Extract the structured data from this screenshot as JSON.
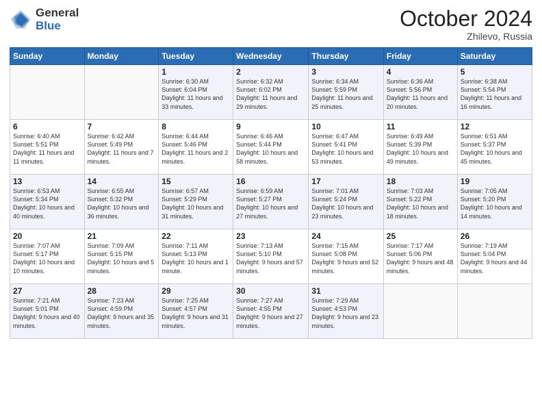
{
  "header": {
    "logo_general": "General",
    "logo_blue": "Blue",
    "month_title": "October 2024",
    "location": "Zhilevo, Russia"
  },
  "weekdays": [
    "Sunday",
    "Monday",
    "Tuesday",
    "Wednesday",
    "Thursday",
    "Friday",
    "Saturday"
  ],
  "weeks": [
    [
      {
        "day": "",
        "info": ""
      },
      {
        "day": "",
        "info": ""
      },
      {
        "day": "1",
        "info": "Sunrise: 6:30 AM\nSunset: 6:04 PM\nDaylight: 11 hours and 33 minutes."
      },
      {
        "day": "2",
        "info": "Sunrise: 6:32 AM\nSunset: 6:02 PM\nDaylight: 11 hours and 29 minutes."
      },
      {
        "day": "3",
        "info": "Sunrise: 6:34 AM\nSunset: 5:59 PM\nDaylight: 11 hours and 25 minutes."
      },
      {
        "day": "4",
        "info": "Sunrise: 6:36 AM\nSunset: 5:56 PM\nDaylight: 11 hours and 20 minutes."
      },
      {
        "day": "5",
        "info": "Sunrise: 6:38 AM\nSunset: 5:54 PM\nDaylight: 11 hours and 16 minutes."
      }
    ],
    [
      {
        "day": "6",
        "info": "Sunrise: 6:40 AM\nSunset: 5:51 PM\nDaylight: 11 hours and 11 minutes."
      },
      {
        "day": "7",
        "info": "Sunrise: 6:42 AM\nSunset: 5:49 PM\nDaylight: 11 hours and 7 minutes."
      },
      {
        "day": "8",
        "info": "Sunrise: 6:44 AM\nSunset: 5:46 PM\nDaylight: 11 hours and 2 minutes."
      },
      {
        "day": "9",
        "info": "Sunrise: 6:46 AM\nSunset: 5:44 PM\nDaylight: 10 hours and 58 minutes."
      },
      {
        "day": "10",
        "info": "Sunrise: 6:47 AM\nSunset: 5:41 PM\nDaylight: 10 hours and 53 minutes."
      },
      {
        "day": "11",
        "info": "Sunrise: 6:49 AM\nSunset: 5:39 PM\nDaylight: 10 hours and 49 minutes."
      },
      {
        "day": "12",
        "info": "Sunrise: 6:51 AM\nSunset: 5:37 PM\nDaylight: 10 hours and 45 minutes."
      }
    ],
    [
      {
        "day": "13",
        "info": "Sunrise: 6:53 AM\nSunset: 5:34 PM\nDaylight: 10 hours and 40 minutes."
      },
      {
        "day": "14",
        "info": "Sunrise: 6:55 AM\nSunset: 5:32 PM\nDaylight: 10 hours and 36 minutes."
      },
      {
        "day": "15",
        "info": "Sunrise: 6:57 AM\nSunset: 5:29 PM\nDaylight: 10 hours and 31 minutes."
      },
      {
        "day": "16",
        "info": "Sunrise: 6:59 AM\nSunset: 5:27 PM\nDaylight: 10 hours and 27 minutes."
      },
      {
        "day": "17",
        "info": "Sunrise: 7:01 AM\nSunset: 5:24 PM\nDaylight: 10 hours and 23 minutes."
      },
      {
        "day": "18",
        "info": "Sunrise: 7:03 AM\nSunset: 5:22 PM\nDaylight: 10 hours and 18 minutes."
      },
      {
        "day": "19",
        "info": "Sunrise: 7:05 AM\nSunset: 5:20 PM\nDaylight: 10 hours and 14 minutes."
      }
    ],
    [
      {
        "day": "20",
        "info": "Sunrise: 7:07 AM\nSunset: 5:17 PM\nDaylight: 10 hours and 10 minutes."
      },
      {
        "day": "21",
        "info": "Sunrise: 7:09 AM\nSunset: 5:15 PM\nDaylight: 10 hours and 5 minutes."
      },
      {
        "day": "22",
        "info": "Sunrise: 7:11 AM\nSunset: 5:13 PM\nDaylight: 10 hours and 1 minute."
      },
      {
        "day": "23",
        "info": "Sunrise: 7:13 AM\nSunset: 5:10 PM\nDaylight: 9 hours and 57 minutes."
      },
      {
        "day": "24",
        "info": "Sunrise: 7:15 AM\nSunset: 5:08 PM\nDaylight: 9 hours and 52 minutes."
      },
      {
        "day": "25",
        "info": "Sunrise: 7:17 AM\nSunset: 5:06 PM\nDaylight: 9 hours and 48 minutes."
      },
      {
        "day": "26",
        "info": "Sunrise: 7:19 AM\nSunset: 5:04 PM\nDaylight: 9 hours and 44 minutes."
      }
    ],
    [
      {
        "day": "27",
        "info": "Sunrise: 7:21 AM\nSunset: 5:01 PM\nDaylight: 9 hours and 40 minutes."
      },
      {
        "day": "28",
        "info": "Sunrise: 7:23 AM\nSunset: 4:59 PM\nDaylight: 9 hours and 35 minutes."
      },
      {
        "day": "29",
        "info": "Sunrise: 7:25 AM\nSunset: 4:57 PM\nDaylight: 9 hours and 31 minutes."
      },
      {
        "day": "30",
        "info": "Sunrise: 7:27 AM\nSunset: 4:55 PM\nDaylight: 9 hours and 27 minutes."
      },
      {
        "day": "31",
        "info": "Sunrise: 7:29 AM\nSunset: 4:53 PM\nDaylight: 9 hours and 23 minutes."
      },
      {
        "day": "",
        "info": ""
      },
      {
        "day": "",
        "info": ""
      }
    ]
  ]
}
